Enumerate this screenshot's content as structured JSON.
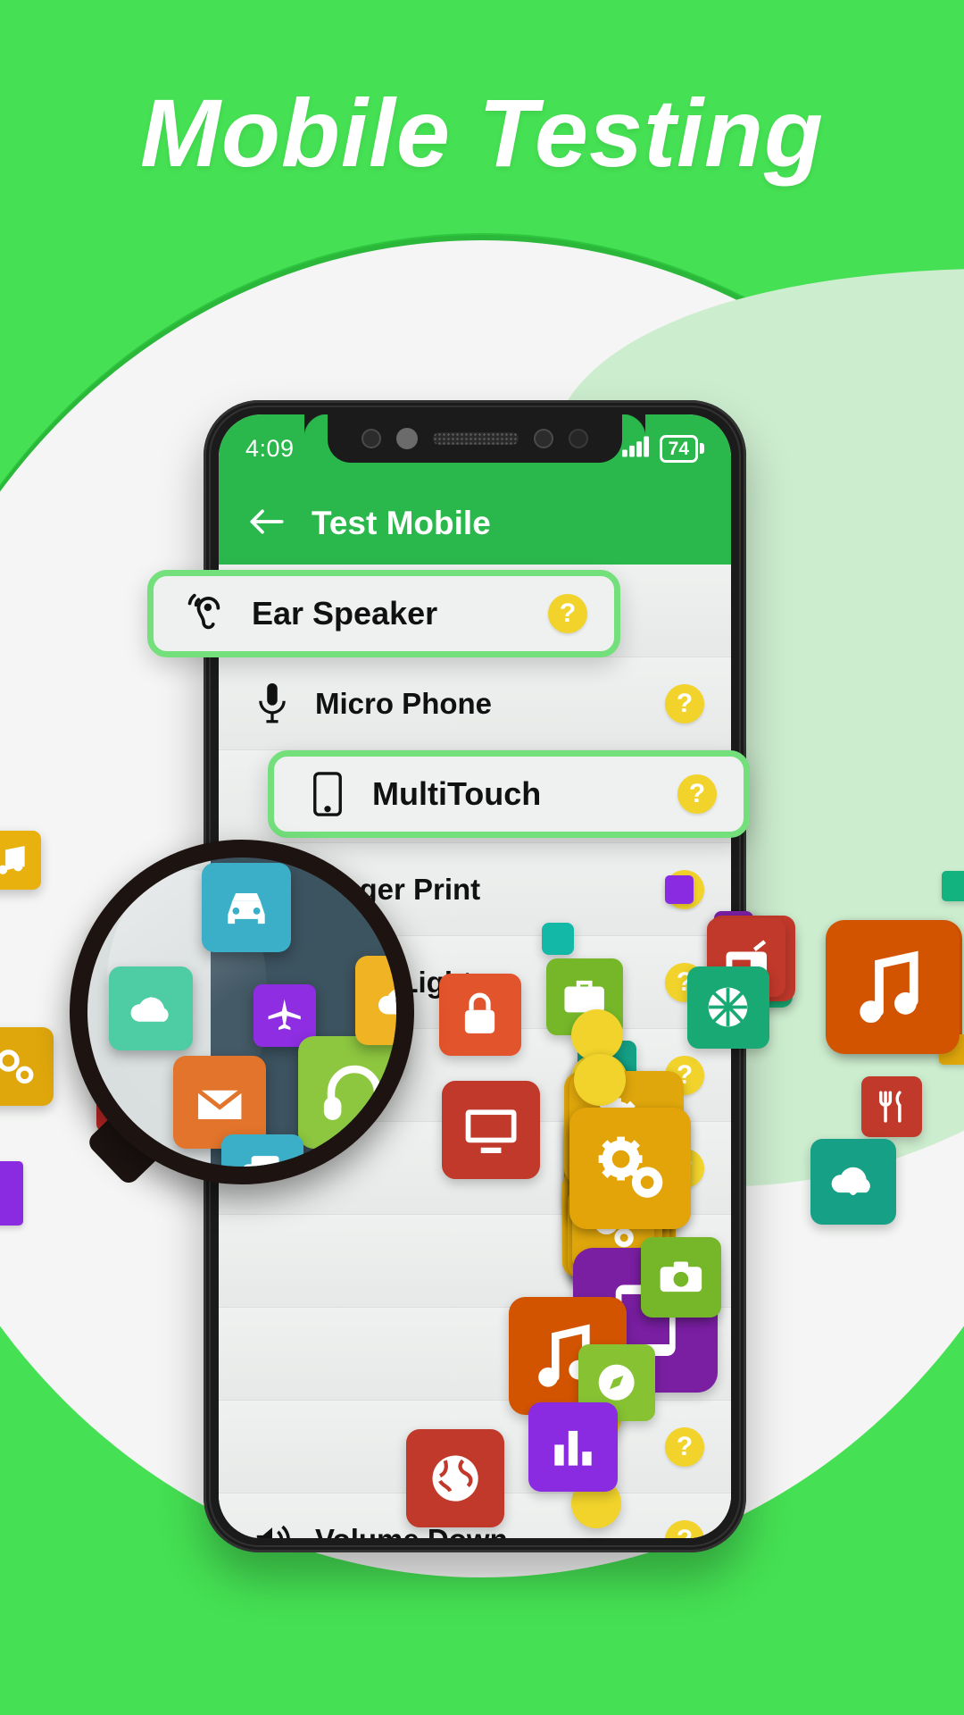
{
  "headline": {
    "text": "Mobile Testing"
  },
  "colors": {
    "brand_green": "#45E053",
    "app_green": "#2AB84C",
    "highlight_green": "#73E07C",
    "card_bg": "#EFF1F0",
    "badge_yellow": "#F1D32B",
    "page_white": "#F4F5F4"
  },
  "phone": {
    "status_bar": {
      "time": "4:09",
      "battery_percent": "74",
      "icons": [
        "wifi-icon",
        "signal-bars-icon",
        "battery-icon"
      ]
    },
    "app_bar": {
      "back_icon": "back-arrow-icon",
      "title": "Test Mobile"
    },
    "list": [
      {
        "label": "Ear Speaker",
        "icon": "ear-speaker-icon",
        "badge": "?",
        "highlighted": true
      },
      {
        "label": "Micro Phone",
        "icon": "microphone-icon",
        "badge": "?",
        "highlighted": false
      },
      {
        "label": "MultiTouch",
        "icon": "phone-screen-icon",
        "badge": "?",
        "highlighted": true
      },
      {
        "label": "Finger Print",
        "icon": "fingerprint-icon",
        "badge": "?",
        "highlighted": false
      },
      {
        "label": "Flash Light",
        "icon": "flashlight-icon",
        "badge": "?",
        "highlighted": false
      },
      {
        "label": "",
        "icon": "",
        "badge": "?",
        "highlighted": false
      },
      {
        "label": "",
        "icon": "",
        "badge": "?",
        "highlighted": false
      },
      {
        "label": "",
        "icon": "",
        "badge": "?",
        "highlighted": false
      },
      {
        "label": "",
        "icon": "",
        "badge": "?",
        "highlighted": false
      },
      {
        "label": "",
        "icon": "",
        "badge": "?",
        "highlighted": false
      },
      {
        "label": "Volume Down",
        "icon": "volume-icon",
        "badge": "?",
        "highlighted": false
      }
    ]
  },
  "magnifier": {
    "icons": [
      "car-icon",
      "cloud-download-icon",
      "airplane-icon",
      "headphones-icon",
      "envelope-icon",
      "cloud-upload-icon",
      "copy-icon"
    ]
  },
  "scattered_icons": [
    "basket-icon",
    "gears-icon",
    "cutlery-icon",
    "cocktail-icon",
    "credit-card-icon",
    "globe-icon",
    "chat-icon",
    "lock-icon",
    "briefcase-icon",
    "thumbs-up-icon",
    "basketball-icon",
    "music-note-icon",
    "tablet-icon",
    "camera-icon",
    "compass-icon",
    "bar-chart-icon",
    "cloud-download-icon",
    "radio-icon",
    "monitor-icon",
    "speech-bubble-icon"
  ]
}
